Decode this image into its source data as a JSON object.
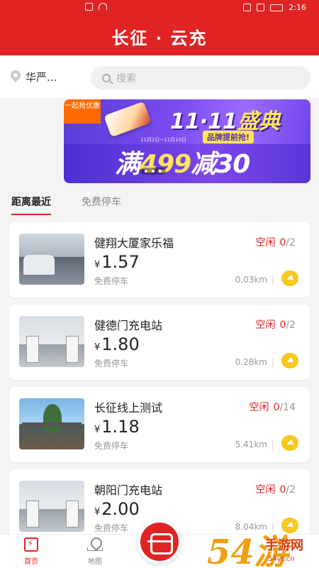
{
  "status_bar": {
    "time": "2:16",
    "icons": [
      "sim-icon",
      "wifi-icon",
      "alarm-icon",
      "mute-icon",
      "signal-icon",
      "battery-icon"
    ]
  },
  "header": {
    "title": "长征 · 云充"
  },
  "location": {
    "city": "华严..."
  },
  "search": {
    "placeholder": "搜索"
  },
  "banner": {
    "tag": "一起抢优惠",
    "headline_a": "11·11",
    "headline_b": "盛典",
    "sub": "品牌提前抢!",
    "date": "11月2日~11月10日",
    "promo_a": "满",
    "promo_num": "499",
    "promo_b": "减30"
  },
  "tabs": [
    {
      "label": "距离最近",
      "active": true
    },
    {
      "label": "免费停车",
      "active": false
    }
  ],
  "stations": [
    {
      "name": "健翔大厦家乐福",
      "currency": "¥",
      "price": "1.57",
      "parking": "免费停车",
      "status": "空闲",
      "available": "0",
      "total": "/2",
      "distance": "0.03km",
      "sep": "|"
    },
    {
      "name": "健德门充电站",
      "currency": "¥",
      "price": "1.80",
      "parking": "免费停车",
      "status": "空闲",
      "available": "0",
      "total": "/2",
      "distance": "0.28km",
      "sep": "|"
    },
    {
      "name": "长征线上测试",
      "currency": "¥",
      "price": "1.18",
      "parking": "免费停车",
      "status": "空闲",
      "available": "0",
      "total": "/14",
      "distance": "5.41km",
      "sep": "|"
    },
    {
      "name": "朝阳门充电站",
      "currency": "¥",
      "price": "2.00",
      "parking": "免费停车",
      "status": "空闲",
      "available": "0",
      "total": "/2",
      "distance": "8.04km",
      "sep": "|"
    }
  ],
  "tabbar": {
    "home": "首页",
    "map": "地图"
  },
  "watermark": {
    "big": "54游",
    "small": "手游网",
    "url": "54yt.cn"
  },
  "colors": {
    "brand_red": "#e02424",
    "nav_yellow": "#f6c821",
    "banner_purple": "#7b4cf0"
  }
}
